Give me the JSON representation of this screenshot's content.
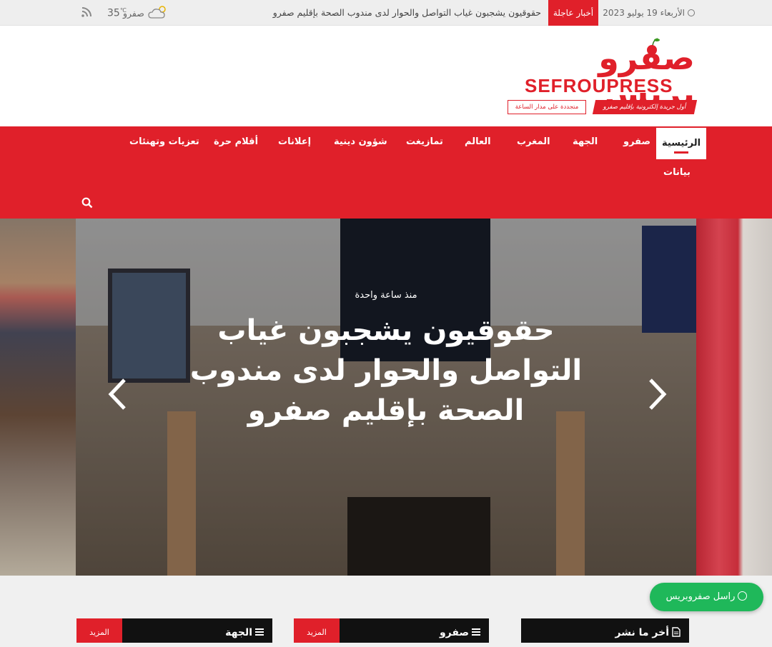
{
  "topbar": {
    "date": "الأربعاء 19 يوليو 2023",
    "breaking_label": "أخبار عاجلة",
    "breaking_text": "حقوقيون يشجبون غياب التواصل والحوار لدى مندوب الصحة بإقليم صفرو",
    "weather_temp": "35",
    "weather_unit": "℃",
    "weather_city": "صفرو",
    "weather_icon": "partly-cloudy-icon",
    "rss_icon": "rss-icon"
  },
  "logo": {
    "arabic": "صفرو بريس",
    "latin": "SEFROUPRESS",
    "tagline_1": "أول جريدة إلكترونية بإقليم صفرو",
    "tagline_2": "متجددة على مدار الساعة"
  },
  "nav": {
    "items": [
      {
        "label": "الرئيسية"
      },
      {
        "label": "صفرو"
      },
      {
        "label": "الجهة"
      },
      {
        "label": "المغرب"
      },
      {
        "label": "العالم"
      },
      {
        "label": "تمازيغت"
      },
      {
        "label": "شؤون دينية"
      },
      {
        "label": "إعلانات"
      },
      {
        "label": "أقلام حرة"
      },
      {
        "label": "تعزيات وتهنئات"
      },
      {
        "label": "بيانات"
      }
    ],
    "search_icon": "search-icon"
  },
  "slider": {
    "time": "منذ ساعة واحدة",
    "title": "حقوقيون يشجبون غياب التواصل والحوار لدى مندوب الصحة بإقليم صفرو"
  },
  "blocks": [
    {
      "title": "أخر ما نشر",
      "more": ""
    },
    {
      "title": "صفرو",
      "more": "المزيد"
    },
    {
      "title": "الجهة",
      "more": "المزيد"
    }
  ],
  "whatsapp": {
    "label": "راسل صفروبريس"
  },
  "colors": {
    "accent": "#e0202a",
    "dark": "#111111",
    "whatsapp": "#1fb85a"
  }
}
